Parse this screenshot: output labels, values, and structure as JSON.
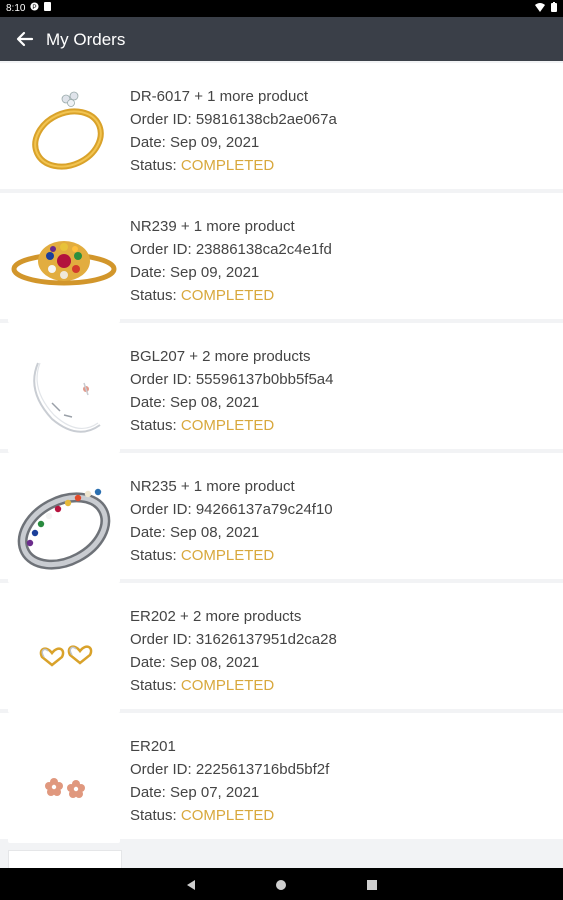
{
  "status_bar": {
    "time": "8:10"
  },
  "app_bar": {
    "title": "My Orders"
  },
  "orders": [
    {
      "title": "DR-6017 + 1 more product",
      "order_id_label": "Order ID: 59816138cb2ae067a",
      "date_label": "Date: Sep 09, 2021",
      "status_label": "Status: ",
      "status_value": "COMPLETED",
      "image_icon": "ring-icon"
    },
    {
      "title": "NR239 + 1 more product",
      "order_id_label": "Order ID: 23886138ca2c4e1fd",
      "date_label": "Date: Sep 09, 2021",
      "status_label": "Status: ",
      "status_value": "COMPLETED",
      "image_icon": "navratna-ring-icon"
    },
    {
      "title": "BGL207 + 2 more products",
      "order_id_label": "Order ID: 55596137b0bb5f5a4",
      "date_label": "Date: Sep 08, 2021",
      "status_label": "Status: ",
      "status_value": "COMPLETED",
      "image_icon": "bracelet-icon"
    },
    {
      "title": "NR235 + 1 more product",
      "order_id_label": "Order ID: 94266137a79c24f10",
      "date_label": "Date: Sep 08, 2021",
      "status_label": "Status: ",
      "status_value": "COMPLETED",
      "image_icon": "band-ring-icon"
    },
    {
      "title": "ER202 + 2 more products",
      "order_id_label": "Order ID: 31626137951d2ca28",
      "date_label": "Date: Sep 08, 2021",
      "status_label": "Status: ",
      "status_value": "COMPLETED",
      "image_icon": "heart-earrings-icon"
    },
    {
      "title": "ER201",
      "order_id_label": "Order ID: 2225613716bd5bf2f",
      "date_label": "Date: Sep 07, 2021",
      "status_label": "Status: ",
      "status_value": "COMPLETED",
      "image_icon": "flower-earrings-icon"
    }
  ],
  "colors": {
    "app_bar": "#3a3f48",
    "status_completed": "#d8a83d",
    "background": "#f2f3f5"
  }
}
